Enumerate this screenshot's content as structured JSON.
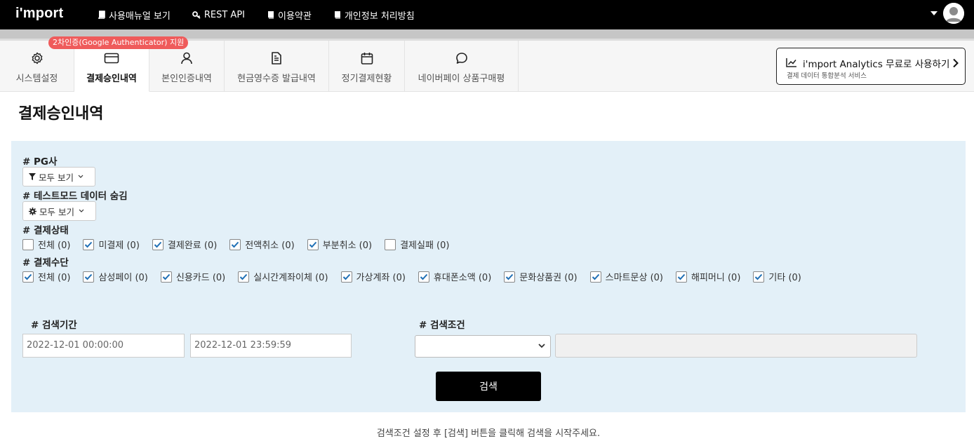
{
  "app": {
    "logo": "i'mport",
    "topnav": [
      {
        "label": "사용매뉴얼 보기",
        "icon": "book-icon"
      },
      {
        "label": "REST API",
        "icon": "key-icon"
      },
      {
        "label": "이용약관",
        "icon": "book-icon"
      },
      {
        "label": "개인정보 처리방침",
        "icon": "book-icon"
      }
    ]
  },
  "tabs": [
    {
      "label": "시스템설정",
      "icon": "gear-icon"
    },
    {
      "label": "결제승인내역",
      "icon": "card-icon",
      "active": true
    },
    {
      "label": "본인인증내역",
      "icon": "user-icon"
    },
    {
      "label": "현금영수증 발급내역",
      "icon": "document-icon"
    },
    {
      "label": "정기결제현황",
      "icon": "calendar-icon"
    },
    {
      "label": "네이버페이 상품구매평",
      "icon": "chat-bubble-icon"
    }
  ],
  "badge": "2차인증(Google Authenticator) 지원",
  "analytics": {
    "title": "i'mport Analytics 무료로 사용하기",
    "subtitle": "결제 데이터 통합분석 서비스"
  },
  "page_title": "결제승인내역",
  "filters": {
    "pg": {
      "label": "# PG사",
      "button": "모두 보기"
    },
    "testmode": {
      "label": "# 테스트모드 데이터 숨김",
      "button": "모두 보기"
    },
    "status": {
      "label": "# 결제상태",
      "options": [
        {
          "label": "전체 (0)",
          "checked": false
        },
        {
          "label": "미결제 (0)",
          "checked": true
        },
        {
          "label": "결제완료 (0)",
          "checked": true
        },
        {
          "label": "전액취소 (0)",
          "checked": true
        },
        {
          "label": "부분취소 (0)",
          "checked": true
        },
        {
          "label": "결제실패 (0)",
          "checked": false
        }
      ]
    },
    "method": {
      "label": "# 결제수단",
      "options": [
        {
          "label": "전체 (0)",
          "checked": true
        },
        {
          "label": "삼성페이 (0)",
          "checked": true
        },
        {
          "label": "신용카드 (0)",
          "checked": true
        },
        {
          "label": "실시간계좌이체 (0)",
          "checked": true
        },
        {
          "label": "가상계좌 (0)",
          "checked": true
        },
        {
          "label": "휴대폰소액 (0)",
          "checked": true
        },
        {
          "label": "문화상품권 (0)",
          "checked": true
        },
        {
          "label": "스마트문상 (0)",
          "checked": true
        },
        {
          "label": "해피머니 (0)",
          "checked": true
        },
        {
          "label": "기타 (0)",
          "checked": true
        }
      ]
    },
    "period": {
      "label": "# 검색기간",
      "from": "2022-12-01 00:00:00",
      "to": "2022-12-01 23:59:59"
    },
    "condition": {
      "label": "# 검색조건",
      "selected": "",
      "keyword": ""
    }
  },
  "search_button": "검색",
  "hint": "검색조건 설정 후 [검색] 버튼을 클릭해 검색을 시작주세요.",
  "colors": {
    "badge": "#ef5b5b",
    "panel": "#e3f0f8",
    "check": "#1f6fb5"
  }
}
